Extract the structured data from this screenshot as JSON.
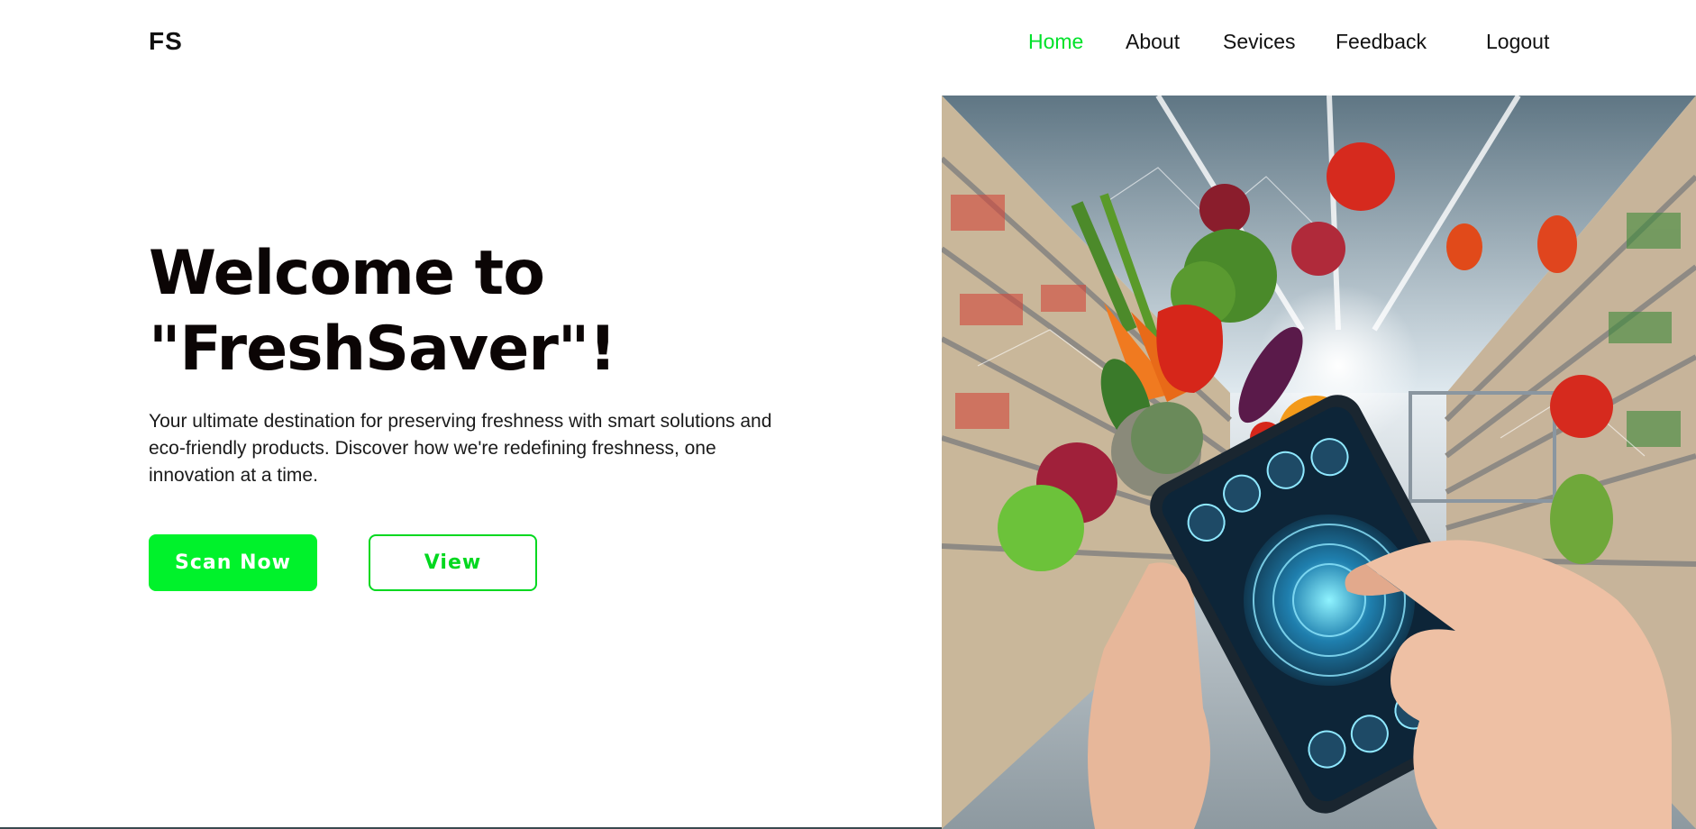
{
  "brand": {
    "logo": "FS"
  },
  "nav": {
    "items": [
      {
        "label": "Home",
        "active": true
      },
      {
        "label": "About",
        "active": false
      },
      {
        "label": "Sevices",
        "active": false
      },
      {
        "label": "Feedback",
        "active": false
      }
    ],
    "logout_label": "Logout",
    "active_color": "#00e22a"
  },
  "hero": {
    "title_line1": "Welcome to",
    "title_line2": "\"FreshSaver\"!",
    "description": "Your ultimate destination for preserving freshness with smart solutions and eco-friendly products. Discover how we're redefining freshness, one innovation at a time.",
    "scan_button": "Scan Now",
    "view_button": "View",
    "accent_color": "#00f22b"
  },
  "image": {
    "icon": "supermarket-smartphone-produce-image"
  }
}
